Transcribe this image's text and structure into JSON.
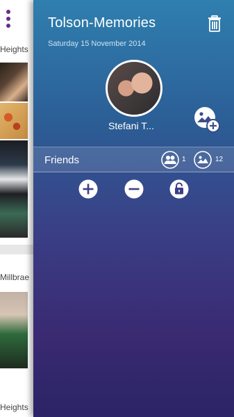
{
  "feed": {
    "labels": [
      "Heights",
      "Millbrae",
      "Heights"
    ]
  },
  "drawer": {
    "title": "Tolson-Memories",
    "date": "Saturday 15 November 2014",
    "member_name": "Stefani T...",
    "friends_label": "Friends",
    "friends_count": "1",
    "photos_count": "12"
  },
  "colors": {
    "menu_accent": "#6a2c87",
    "drawer_top": "#2f7faf",
    "drawer_bottom": "#2b2466"
  },
  "icons": {
    "menu": "vertical-dots-icon",
    "trash": "trash-icon",
    "add_photo": "add-photo-icon",
    "friends": "group-icon",
    "photos": "photo-icon",
    "add": "plus-circle-icon",
    "remove": "minus-circle-icon",
    "lock": "unlock-icon"
  }
}
